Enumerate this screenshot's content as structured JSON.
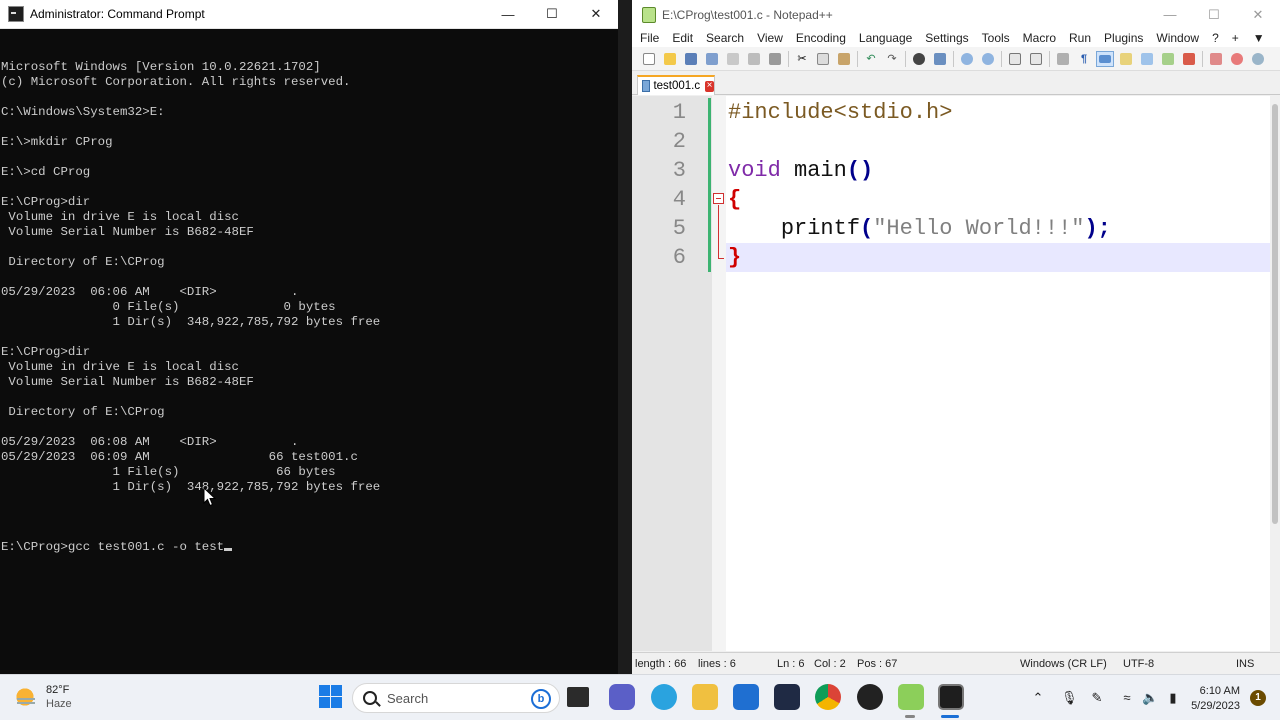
{
  "cmd": {
    "title": "Administrator: Command Prompt",
    "lines": [
      "Microsoft Windows [Version 10.0.22621.1702]",
      "(c) Microsoft Corporation. All rights reserved.",
      "",
      "C:\\Windows\\System32>E:",
      "",
      "E:\\>mkdir CProg",
      "",
      "E:\\>cd CProg",
      "",
      "E:\\CProg>dir",
      " Volume in drive E is local disc",
      " Volume Serial Number is B682-48EF",
      "",
      " Directory of E:\\CProg",
      "",
      "05/29/2023  06:06 AM    <DIR>          .",
      "               0 File(s)              0 bytes",
      "               1 Dir(s)  348,922,785,792 bytes free",
      "",
      "E:\\CProg>dir",
      " Volume in drive E is local disc",
      " Volume Serial Number is B682-48EF",
      "",
      " Directory of E:\\CProg",
      "",
      "05/29/2023  06:08 AM    <DIR>          .",
      "05/29/2023  06:09 AM                66 test001.c",
      "               1 File(s)             66 bytes",
      "               1 Dir(s)  348,922,785,792 bytes free",
      ""
    ],
    "prompt_line": "E:\\CProg>gcc test001.c -o test"
  },
  "npp": {
    "title": "E:\\CProg\\test001.c - Notepad++",
    "menu": [
      "File",
      "Edit",
      "Search",
      "View",
      "Encoding",
      "Language",
      "Settings",
      "Tools",
      "Macro",
      "Run",
      "Plugins",
      "Window",
      "?"
    ],
    "menu_right": [
      "+",
      "▼",
      "✕"
    ],
    "tab_label": "test001.c",
    "line_numbers": [
      "1",
      "2",
      "3",
      "4",
      "5",
      "6"
    ],
    "code": {
      "l1": "#include<stdio.h>",
      "l3_kw": "void",
      "l3_fn": " main",
      "l3_paren": "()",
      "l4_brace": "{",
      "l5_indent": "    ",
      "l5_fn": "printf",
      "l5_open": "(",
      "l5_str": "\"Hello World!!!\"",
      "l5_close": ");",
      "l6_brace": "}"
    },
    "status": {
      "length": "length : 66",
      "lines": "lines : 6",
      "ln": "Ln : 6",
      "col": "Col : 2",
      "pos": "Pos : 67",
      "eol": "Windows (CR LF)",
      "encoding": "UTF-8",
      "mode": "INS"
    }
  },
  "taskbar": {
    "weather_temp": "82°F",
    "weather_desc": "Haze",
    "search_placeholder": "Search",
    "bing_label": "b",
    "clock_time": "6:10 AM",
    "clock_date": "5/29/2023",
    "notification_count": "1"
  }
}
